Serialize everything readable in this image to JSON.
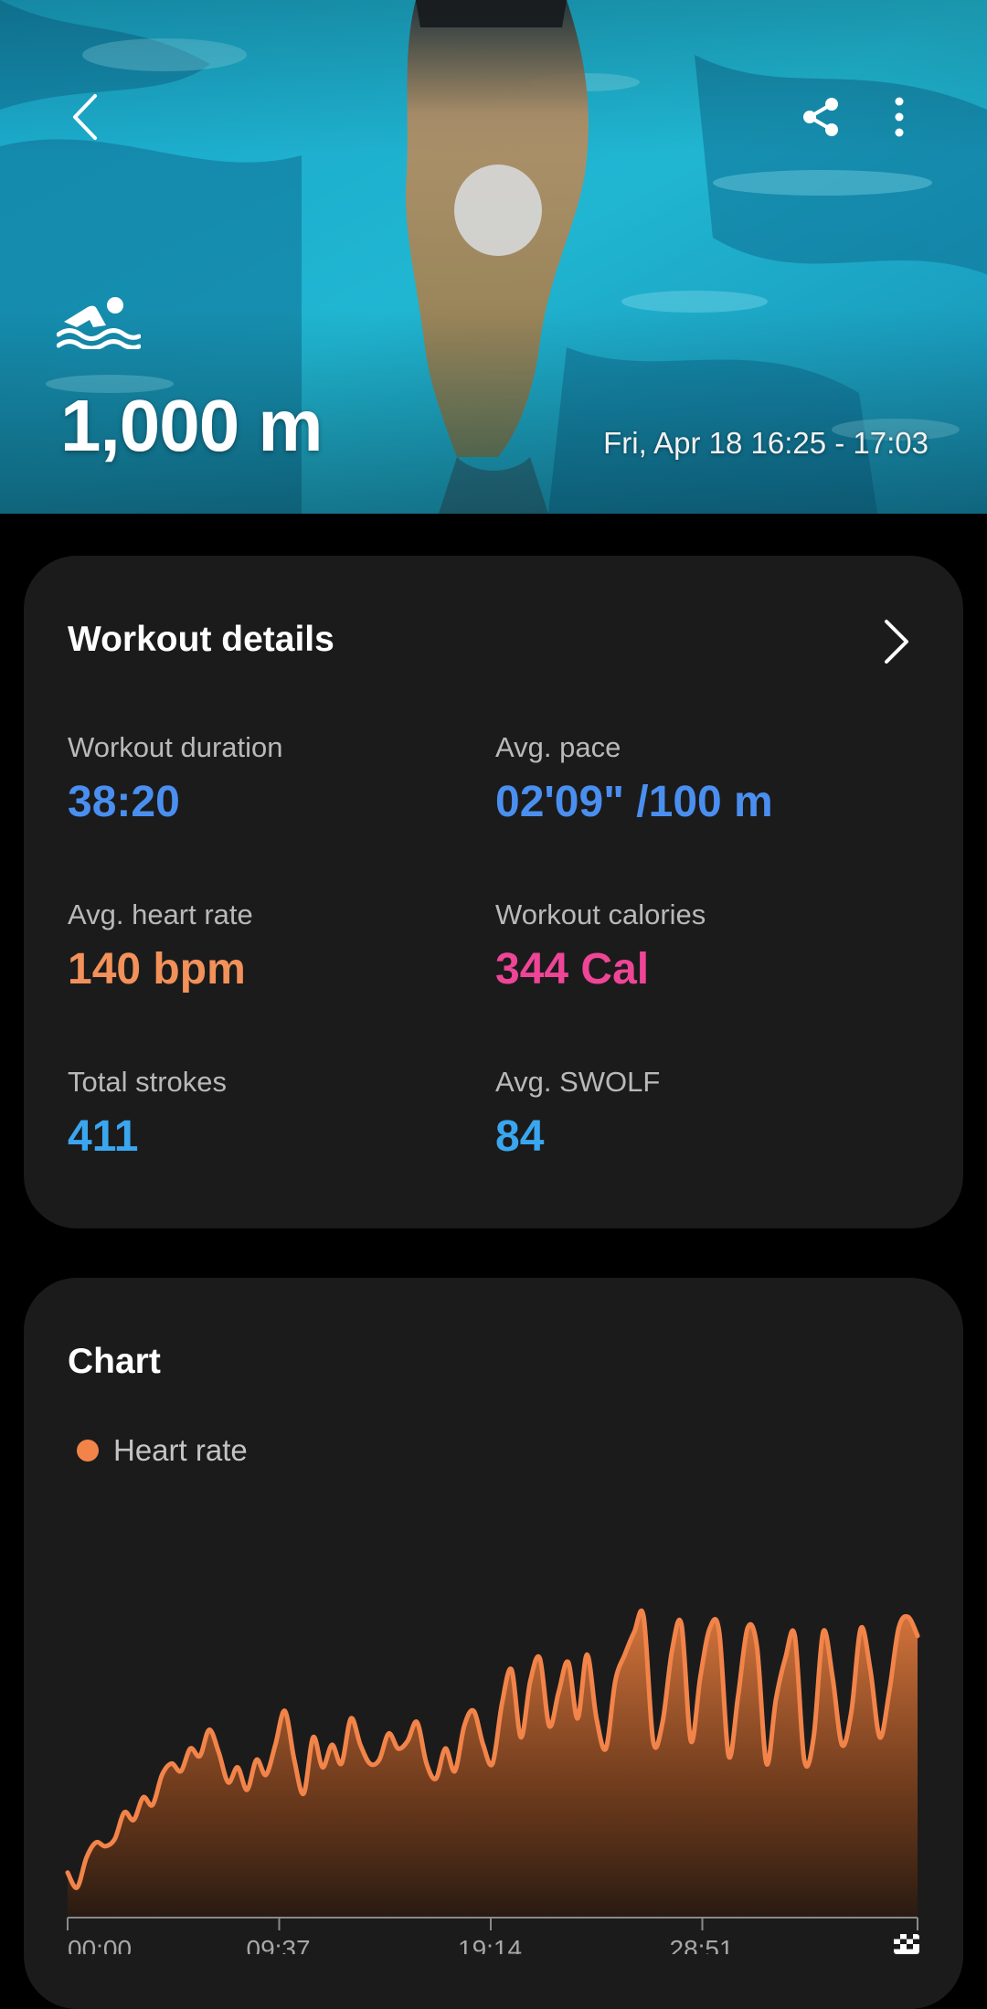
{
  "header": {
    "distance": "1,000 m",
    "session_time": "Fri, Apr 18 16:25 - 17:03",
    "icons": {
      "back": "chevron-left-icon",
      "share": "share-icon",
      "more": "more-vertical-icon",
      "activity": "swimming-icon"
    }
  },
  "details": {
    "title": "Workout details",
    "metrics": [
      {
        "label": "Workout duration",
        "value": "38:20",
        "color": "#4a8ff0"
      },
      {
        "label": "Avg. pace",
        "value": "02'09\" /100 m",
        "color": "#4a8ff0"
      },
      {
        "label": "Avg. heart rate",
        "value": "140 bpm",
        "color": "#f2915a"
      },
      {
        "label": "Workout calories",
        "value": "344 Cal",
        "color": "#ee4597"
      },
      {
        "label": "Total strokes",
        "value": "411",
        "color": "#3aa6f0"
      },
      {
        "label": "Avg. SWOLF",
        "value": "84",
        "color": "#3aa6f0"
      }
    ]
  },
  "chart_section": {
    "title": "Chart",
    "legend_label": "Heart rate",
    "accent": "#f2844a",
    "finish_icon": "checkered-flag-icon"
  },
  "chart_data": {
    "type": "area",
    "series": [
      {
        "name": "Heart rate"
      }
    ],
    "x_ticks": [
      "00:00",
      "09:37",
      "19:14",
      "28:51"
    ],
    "x": [
      0,
      0.4,
      0.8,
      1.2,
      1.6,
      2.0,
      2.4,
      2.8,
      3.2,
      3.6,
      4.0,
      4.4,
      4.8,
      5.2,
      5.6,
      6.0,
      6.4,
      6.8,
      7.2,
      7.6,
      8.0,
      8.4,
      8.8,
      9.2,
      9.6,
      10.0,
      10.4,
      10.8,
      11.2,
      11.6,
      12.0,
      12.4,
      12.8,
      13.2,
      13.6,
      14.0,
      14.4,
      14.8,
      15.2,
      15.6,
      16.0,
      16.4,
      16.8,
      17.2,
      17.6,
      18.0,
      18.4,
      18.8,
      19.2,
      19.6,
      20.0,
      20.4,
      20.8,
      21.2,
      21.6,
      22.0,
      22.4,
      22.8,
      23.2,
      23.6,
      24.0,
      24.4,
      24.8,
      25.2,
      25.6,
      26.0,
      26.4,
      26.8,
      27.2,
      27.6,
      28.0,
      28.4,
      28.8,
      29.2,
      29.6,
      30.0,
      30.4,
      30.8,
      31.2,
      31.6,
      32.0,
      32.4,
      32.8,
      33.2,
      33.6,
      34.0,
      34.4,
      34.8,
      35.2,
      35.6,
      36.0
    ],
    "y": [
      92,
      88,
      96,
      100,
      99,
      101,
      108,
      106,
      112,
      110,
      118,
      121,
      119,
      125,
      123,
      130,
      124,
      116,
      120,
      114,
      122,
      118,
      126,
      135,
      122,
      113,
      128,
      120,
      126,
      121,
      133,
      126,
      121,
      122,
      129,
      125,
      127,
      132,
      121,
      117,
      125,
      119,
      131,
      135,
      126,
      121,
      137,
      146,
      128,
      143,
      149,
      131,
      140,
      148,
      133,
      150,
      133,
      125,
      143,
      150,
      156,
      160,
      127,
      132,
      151,
      158,
      127,
      144,
      157,
      156,
      123,
      139,
      157,
      152,
      121,
      138,
      149,
      155,
      122,
      128,
      156,
      144,
      126,
      135,
      157,
      146,
      128,
      140,
      157,
      160,
      155
    ],
    "xlim": [
      0,
      36
    ],
    "ylim": [
      80,
      170
    ],
    "grid": false,
    "legend": "top-left"
  }
}
